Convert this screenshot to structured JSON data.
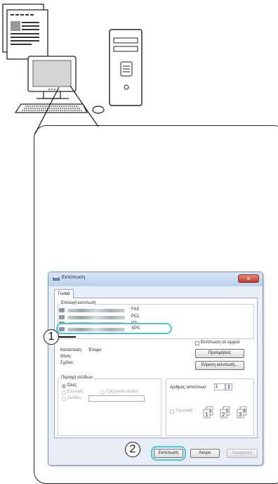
{
  "dialog": {
    "title": "Εκτύπωση",
    "close_glyph": "✕",
    "tab_general": "Γενικά",
    "select_printer_label": "Επιλογή εκτυπωτή",
    "printers": [
      {
        "name": "FAX",
        "icon": "printer-icon"
      },
      {
        "name": "PCL",
        "icon": "printer-icon"
      },
      {
        "name": "PS",
        "icon": "printer-icon"
      },
      {
        "name": "XPS",
        "icon": "printer-icon"
      }
    ],
    "print_to_file_label": "Εκτύπωση σε αρχείο",
    "status_label": "Κατάσταση:",
    "status_value": "Έτοιμο",
    "location_label": "Θέση:",
    "comment_label": "Σχόλιο:",
    "preferences_button": "Προτιμήσεις",
    "find_printer_button": "Εύρεση εκτυπωτή...",
    "page_range_label": "Περιοχή σελίδων",
    "all_label": "Όλες",
    "selection_label": "Επιλογή",
    "current_page_label": "Τρέχουσα σελίδα",
    "pages_label": "Σελίδες:",
    "copies_label": "Αριθμός αντιτύπων:",
    "copies_value": "1",
    "collate_label": "Συρραφή",
    "print_button": "Εκτύπωση",
    "cancel_button": "Άκυρο",
    "apply_button": "Εφαρμογή"
  },
  "callouts": {
    "step1": "1",
    "step2": "2"
  },
  "colors": {
    "highlight": "#4fc3d9",
    "selected_radio": "#2a62c9"
  }
}
